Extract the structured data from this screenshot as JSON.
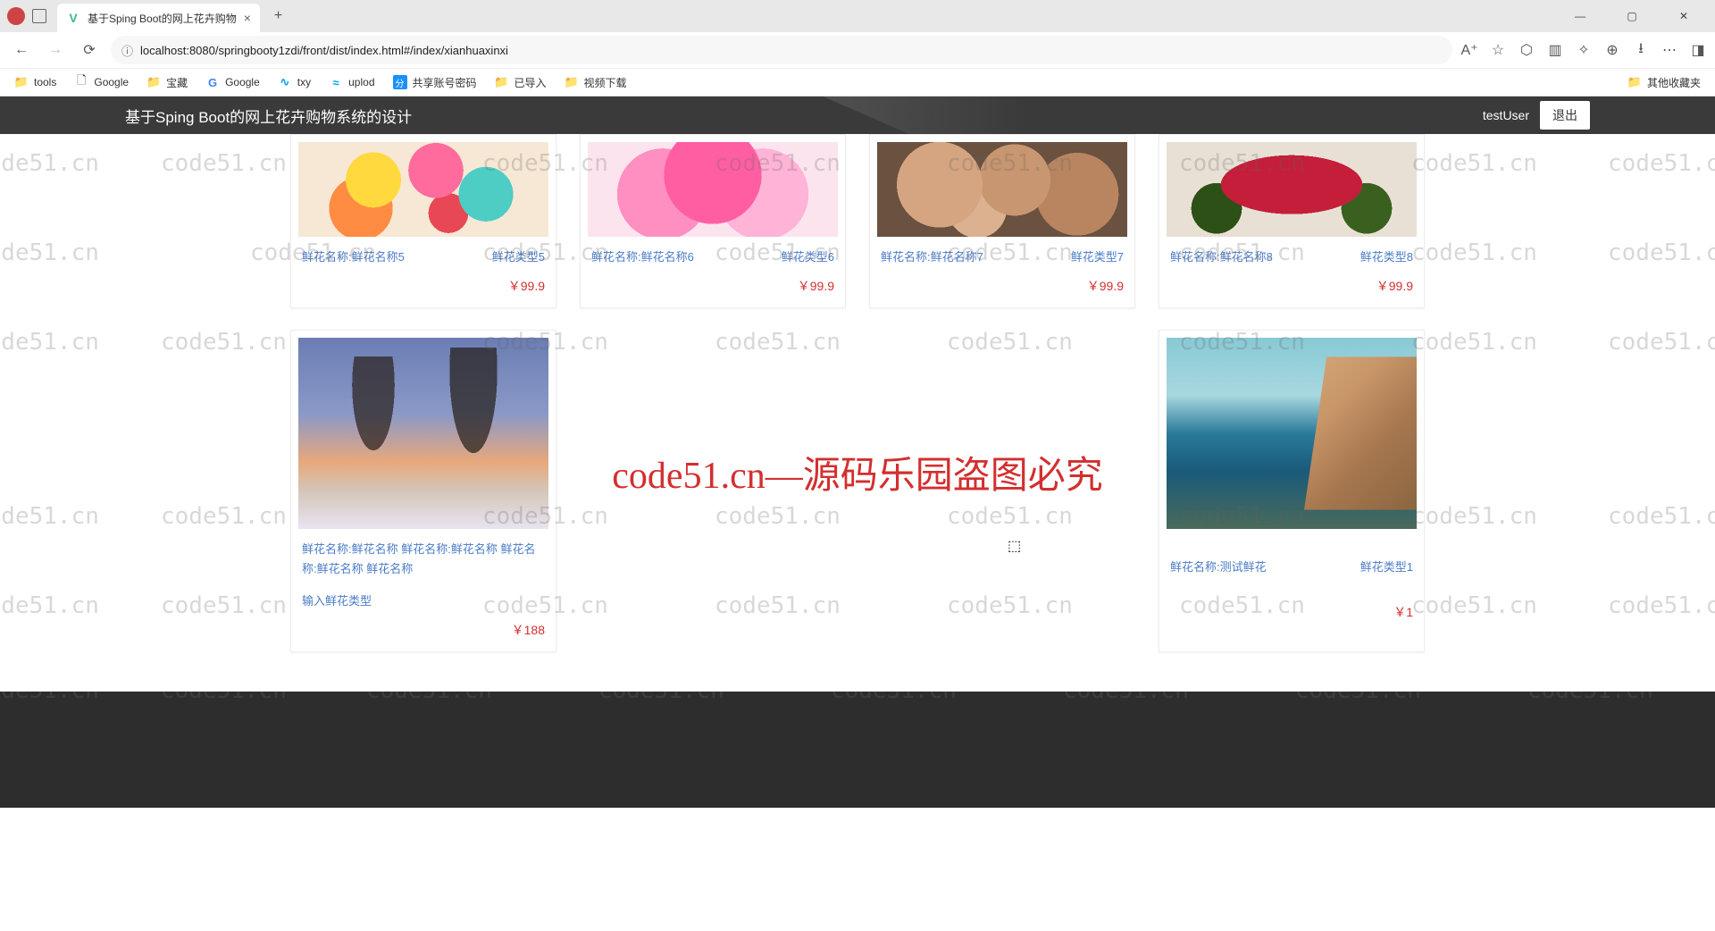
{
  "browser": {
    "tab_title": "基于Sping Boot的网上花卉购物",
    "url_host": "localhost",
    "url_path": ":8080/springbooty1zdi/front/dist/index.html#/index/xianhuaxinxi",
    "bookmarks": [
      {
        "label": "tools",
        "icon": "folder"
      },
      {
        "label": "Google",
        "icon": "page"
      },
      {
        "label": "宝藏",
        "icon": "folder"
      },
      {
        "label": "Google",
        "icon": "g"
      },
      {
        "label": "txy",
        "icon": "txy"
      },
      {
        "label": "uplod",
        "icon": "uplod"
      },
      {
        "label": "共享账号密码",
        "icon": "share"
      },
      {
        "label": "已导入",
        "icon": "folder"
      },
      {
        "label": "视频下载",
        "icon": "video"
      }
    ],
    "other_bookmarks": "其他收藏夹"
  },
  "header": {
    "site_title": "基于Sping Boot的网上花卉购物系统的设计",
    "username": "testUser",
    "logout_label": "退出"
  },
  "watermark_text": "code51.cn",
  "watermark_center": "code51.cn—源码乐园盗图必究",
  "products_row1": [
    {
      "name": "鲜花名称:鲜花名称5",
      "type": "鲜花类型5",
      "price": "￥99.9",
      "img": "img-paper-flowers"
    },
    {
      "name": "鲜花名称:鲜花名称6",
      "type": "鲜花类型6",
      "price": "￥99.9",
      "img": "img-pink-bouquet"
    },
    {
      "name": "鲜花名称:鲜花名称7",
      "type": "鲜花类型7",
      "price": "￥99.9",
      "img": "img-roses-beige"
    },
    {
      "name": "鲜花名称:鲜花名称8",
      "type": "鲜花类型8",
      "price": "￥99.9",
      "img": "img-red-roses"
    }
  ],
  "products_row2": [
    {
      "name": "鲜花名称:鲜花名称 鲜花名称:鲜花名称 鲜花名称:鲜花名称 鲜花名称",
      "type": "输入鲜花类型",
      "price": "￥188",
      "img": "img-trees"
    },
    {
      "blank": true
    },
    {
      "blank": true
    },
    {
      "name": "鲜花名称:测试鲜花",
      "type": "鲜花类型1",
      "price": "￥1",
      "img": "img-coastal"
    }
  ]
}
